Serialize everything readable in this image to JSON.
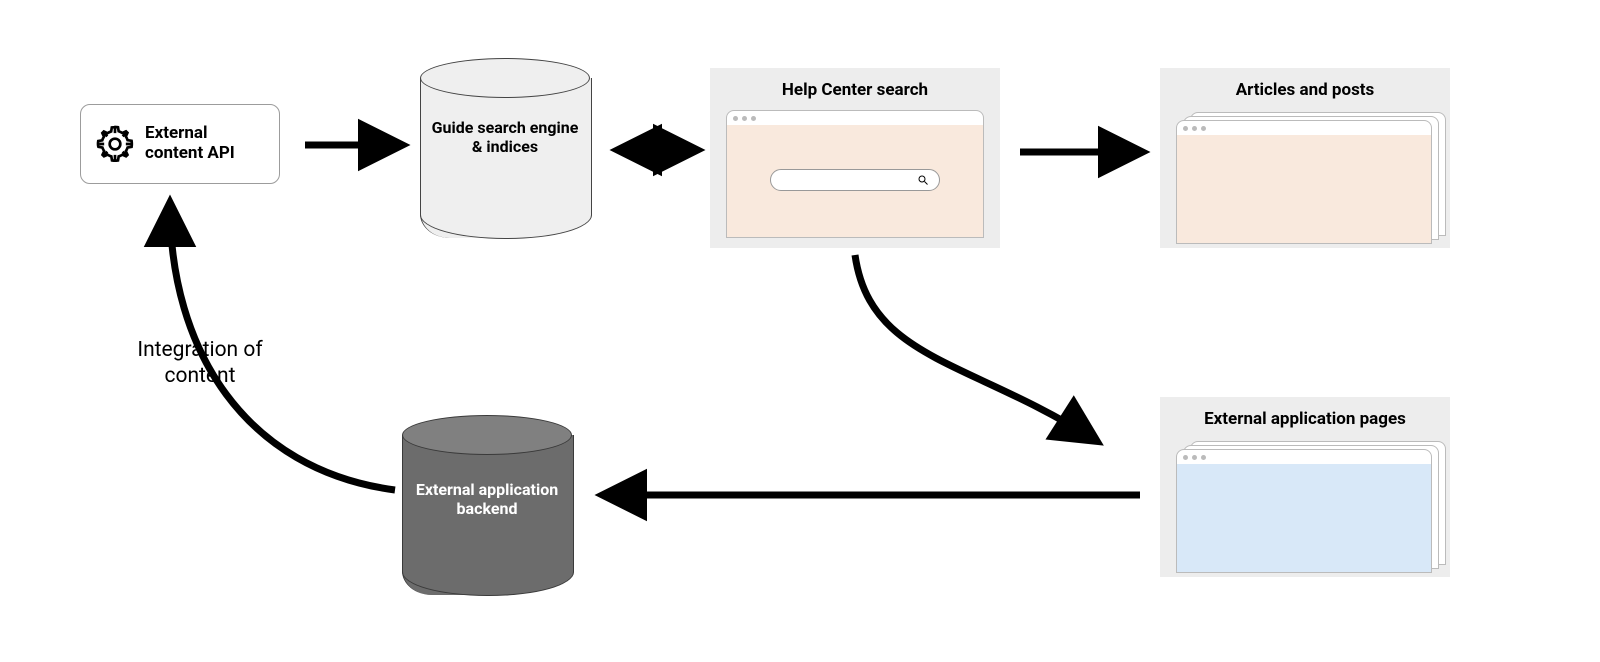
{
  "nodes": {
    "api": {
      "label": "External content API"
    },
    "guide_db": {
      "label": "Guide search engine & indices"
    },
    "help_center": {
      "title": "Help Center search"
    },
    "articles": {
      "title": "Articles and posts"
    },
    "ext_pages": {
      "title": "External application pages"
    },
    "ext_backend": {
      "label": "External application backend"
    }
  },
  "annotations": {
    "integration": "Integration of content"
  },
  "edges": [
    {
      "from": "api",
      "to": "guide_db",
      "type": "arrow"
    },
    {
      "from": "guide_db",
      "to": "help_center",
      "type": "double-arrow"
    },
    {
      "from": "help_center",
      "to": "articles",
      "type": "arrow"
    },
    {
      "from": "help_center",
      "to": "ext_pages",
      "type": "curved-arrow"
    },
    {
      "from": "ext_pages",
      "to": "ext_backend",
      "type": "arrow"
    },
    {
      "from": "ext_backend",
      "to": "api",
      "type": "curved-arrow",
      "label_ref": "annotations.integration"
    }
  ],
  "colors": {
    "panel_bg": "#ededed",
    "peach": "#f9e9dd",
    "blue": "#d8e8f8",
    "cyl_light": "#efefef",
    "cyl_dark": "#6c6c6c"
  }
}
